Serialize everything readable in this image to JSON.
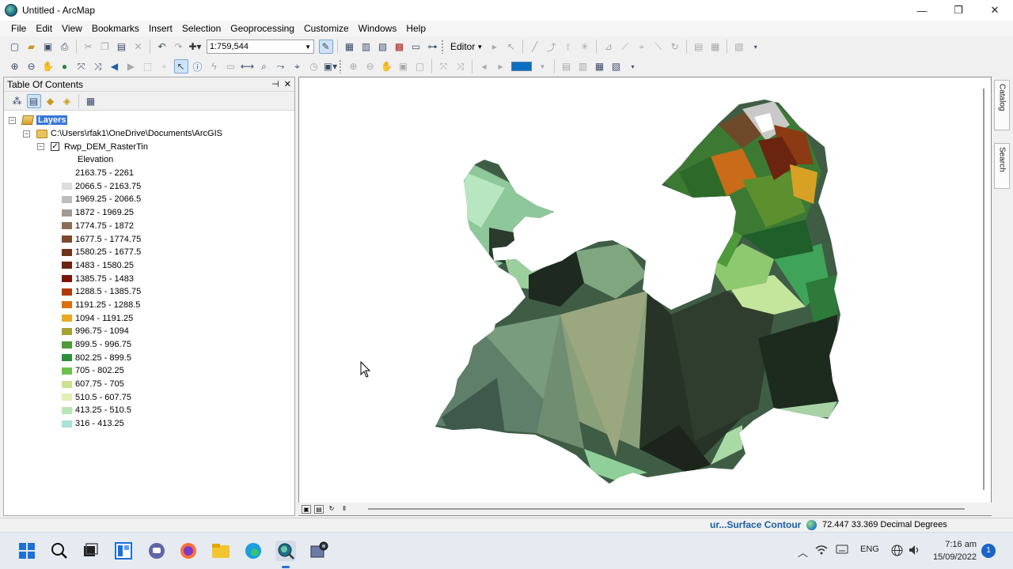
{
  "window": {
    "title": "Untitled - ArcMap",
    "controls": {
      "minimize": "—",
      "maximize": "❐",
      "close": "✕"
    }
  },
  "menu": [
    "File",
    "Edit",
    "View",
    "Bookmarks",
    "Insert",
    "Selection",
    "Geoprocessing",
    "Customize",
    "Windows",
    "Help"
  ],
  "toolbar": {
    "scale": "1:759,544",
    "editor_label": "Editor"
  },
  "toc": {
    "title": "Table Of Contents",
    "header_buttons": {
      "pin": "⊣",
      "close": "✕"
    },
    "root_label": "Layers",
    "folder_path": "C:\\Users\\rfak1\\OneDrive\\Documents\\ArcGIS",
    "layer_name": "Rwp_DEM_RasterTin",
    "field_label": "Elevation",
    "legend": [
      {
        "label": "2163.75 - 2261",
        "color": "#ffffff"
      },
      {
        "label": "2066.5 - 2163.75",
        "color": "#dcdcdc"
      },
      {
        "label": "1969.25 - 2066.5",
        "color": "#bdbdbd"
      },
      {
        "label": "1872 - 1969.25",
        "color": "#a39b93"
      },
      {
        "label": "1774.75 - 1872",
        "color": "#8c6d57"
      },
      {
        "label": "1677.5 - 1774.75",
        "color": "#7a4a2b"
      },
      {
        "label": "1580.25 - 1677.5",
        "color": "#6e3419"
      },
      {
        "label": "1483 - 1580.25",
        "color": "#6a2410"
      },
      {
        "label": "1385.75 - 1483",
        "color": "#7a1508"
      },
      {
        "label": "1288.5 - 1385.75",
        "color": "#b03a0a"
      },
      {
        "label": "1191.25 - 1288.5",
        "color": "#d87010"
      },
      {
        "label": "1094 - 1191.25",
        "color": "#e8a823"
      },
      {
        "label": "996.75 - 1094",
        "color": "#a4a233"
      },
      {
        "label": "899.5 - 996.75",
        "color": "#4f9a3a"
      },
      {
        "label": "802.25 - 899.5",
        "color": "#2d8f3a"
      },
      {
        "label": "705 - 802.25",
        "color": "#6cbf4a"
      },
      {
        "label": "607.75 - 705",
        "color": "#c8e493"
      },
      {
        "label": "510.5 - 607.75",
        "color": "#dff0b5"
      },
      {
        "label": "413.25 - 510.5",
        "color": "#b9e6b9"
      },
      {
        "label": "316 - 413.25",
        "color": "#a9e3d6"
      }
    ]
  },
  "side_tabs": [
    "Catalog",
    "Search"
  ],
  "status": {
    "tool": "ur...Surface Contour",
    "coords": "72.447  33.369 Decimal Degrees"
  },
  "taskbar": {
    "tray_lang": "ENG",
    "time": "7:16 am",
    "date": "15/09/2022",
    "notifications": "1"
  }
}
